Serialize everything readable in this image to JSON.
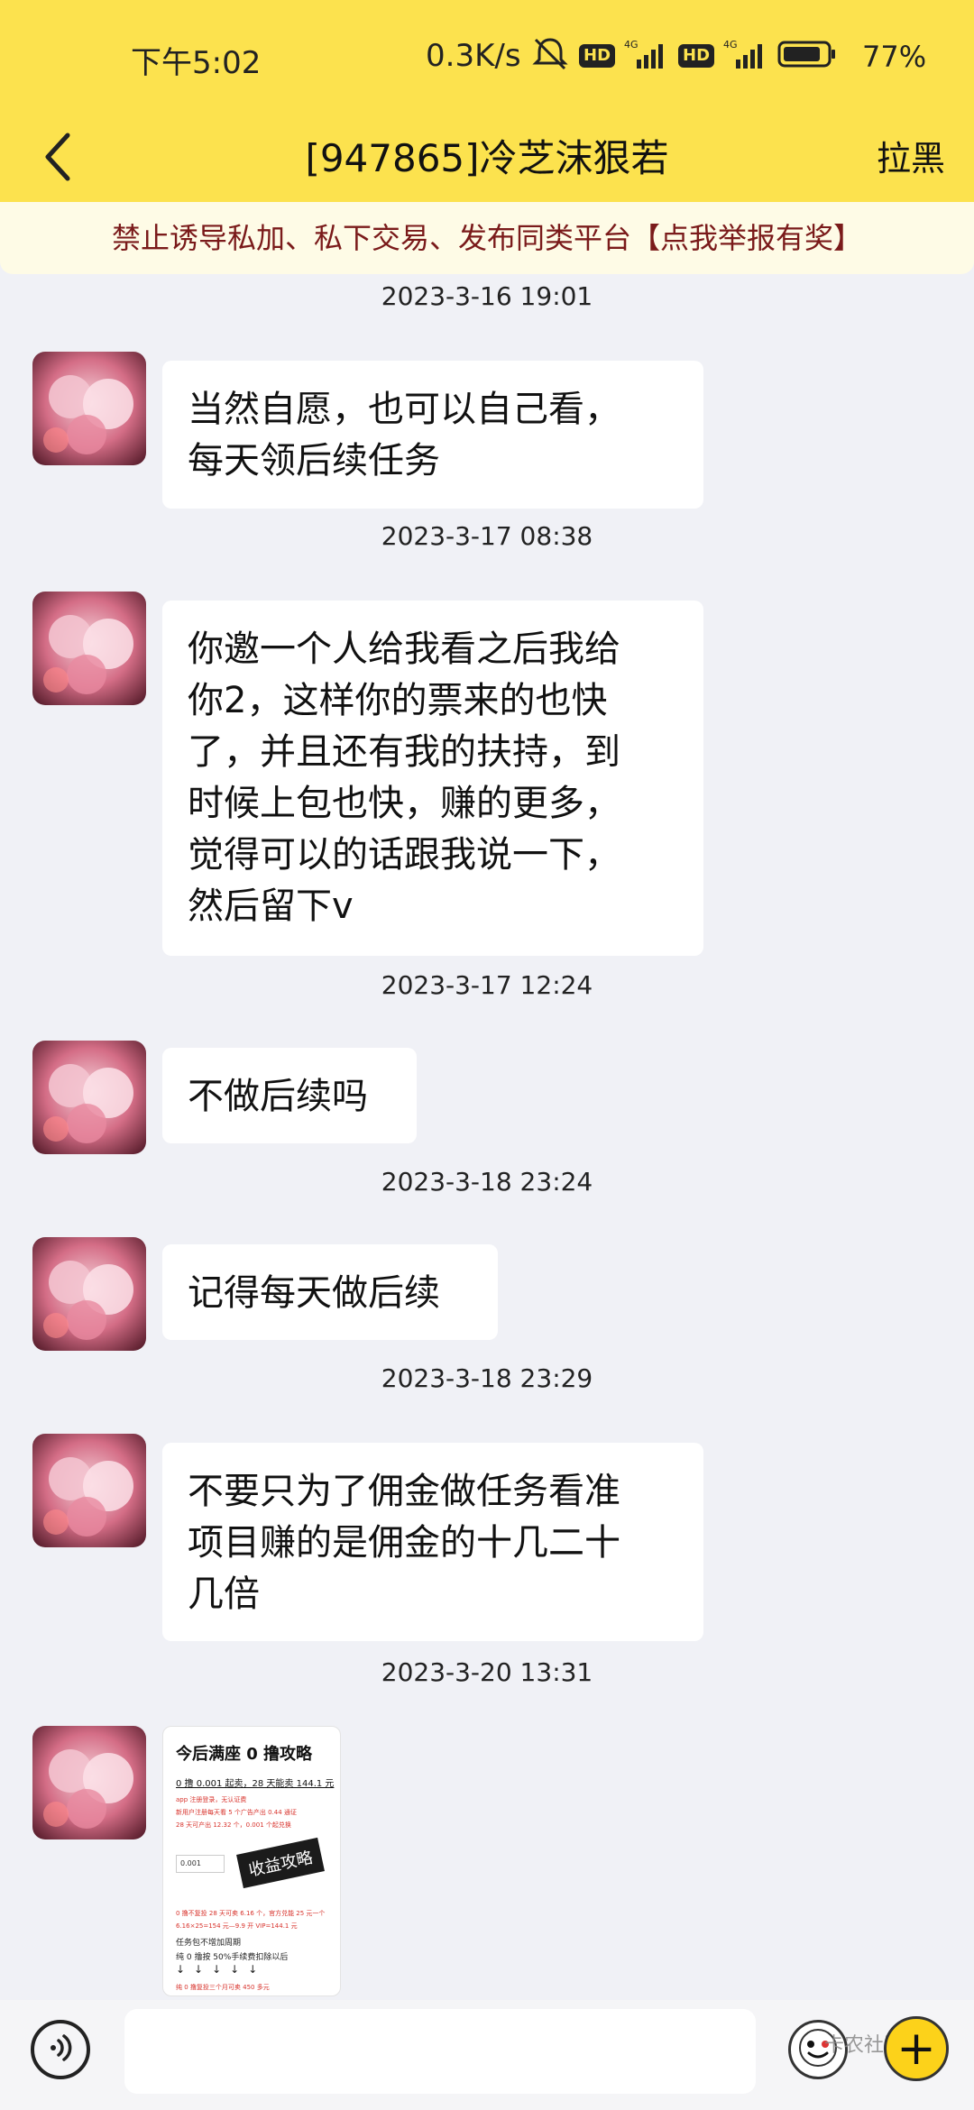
{
  "status_bar": {
    "time": "下午5:02",
    "net_speed": "0.3K/s",
    "hd_label": "HD",
    "network_label": "4G",
    "battery": "77%"
  },
  "header": {
    "title": "[947865]冷芝沫狠若",
    "block_label": "拉黑"
  },
  "notice": {
    "text": "禁止诱导私加、私下交易、发布同类平台",
    "link": "【点我举报有奖】"
  },
  "messages": [
    {
      "timestamp": "2023-3-16 19:01",
      "text": "当然自愿，也可以自己看，\n每天领后续任务"
    },
    {
      "timestamp": "2023-3-17 08:38",
      "text": "你邀一个人给我看之后我给\n你2，这样你的票来的也快\n了，并且还有我的扶持，到\n时候上包也快，赚的更多，\n觉得可以的话跟我说一下，\n然后留下v"
    },
    {
      "timestamp": "2023-3-17 12:24",
      "text": "不做后续吗"
    },
    {
      "timestamp": "2023-3-18 23:24",
      "text": "记得每天做后续"
    },
    {
      "timestamp": "2023-3-18 23:29",
      "text": "不要只为了佣金做任务看准\n项目赚的是佣金的十几二十\n几倍"
    },
    {
      "timestamp": "2023-3-20 13:31",
      "image": {
        "title": "今后满座 0 撸攻略",
        "subtitle": "0 撸 0.001 起卖，28 天能卖 144.1 元",
        "lines": [
          "app 注册登录，无认证费",
          "新用户注册每天看 5 个广告产出 0.44 通证",
          "28 天可产出 12.32 个，0.001 个起兑换",
          "0 撸不复投 28 天可卖 6.16 个，官方兑能 25 元一个",
          "6.16×25=154 元—9.9 开 VIP=144.1 元",
          "任务包不增加周期",
          "纯 0 撸按 50%手续费扣除以后",
          "纯 0 撸复投三个月可卖 450 多元"
        ],
        "input_value": "0.001",
        "tag": "收益攻略"
      }
    }
  ],
  "bottom_bar": {
    "input_placeholder": "",
    "plus_label": "+",
    "watermark": "卡农社区"
  },
  "colors": {
    "header_bg": "#fce24e",
    "chat_bg": "#f0f1f6",
    "notice_text": "#7a1a1a",
    "plus_button": "#fcd21a"
  },
  "icons": [
    "back-arrow-icon",
    "mute-icon",
    "signal-icon",
    "battery-icon",
    "voice-icon",
    "emoji-icon",
    "plus-icon"
  ]
}
